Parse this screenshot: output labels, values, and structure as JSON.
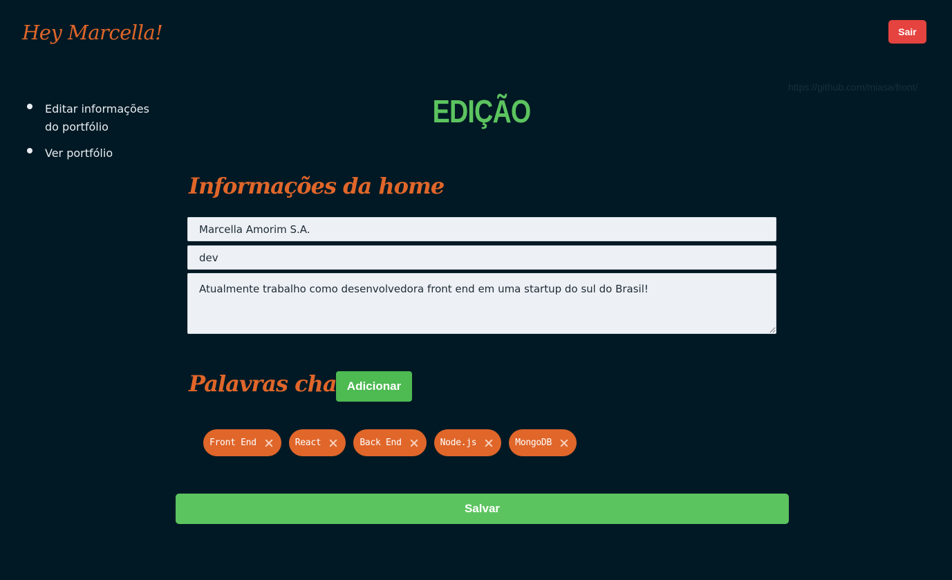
{
  "header": {
    "greeting": "Hey Marcella!",
    "logout_label": "Sair",
    "url_hint": "https://github.com/miasa/front/"
  },
  "sidebar": {
    "items": [
      {
        "label": "Editar informações do portfólio"
      },
      {
        "label": "Ver portfólio"
      }
    ]
  },
  "page": {
    "title": "EDIÇÃO"
  },
  "home_info": {
    "section_title": "Informações da home",
    "name_value": "Marcella Amorim S.A.",
    "role_value": "dev",
    "bio_value": "Atualmente trabalho como desenvolvedora front end em uma startup do sul do Brasil!"
  },
  "keywords": {
    "section_title": "Palavras chave",
    "add_label": "Adicionar",
    "tags": [
      "Front End",
      "React",
      "Back End",
      "Node.js",
      "MongoDB"
    ]
  },
  "actions": {
    "save_label": "Salvar"
  },
  "colors": {
    "background": "#011924",
    "accent_orange": "#e0662a",
    "accent_green": "#5cc45f",
    "danger_red": "#e5433f",
    "field_background": "#edf1f6"
  }
}
